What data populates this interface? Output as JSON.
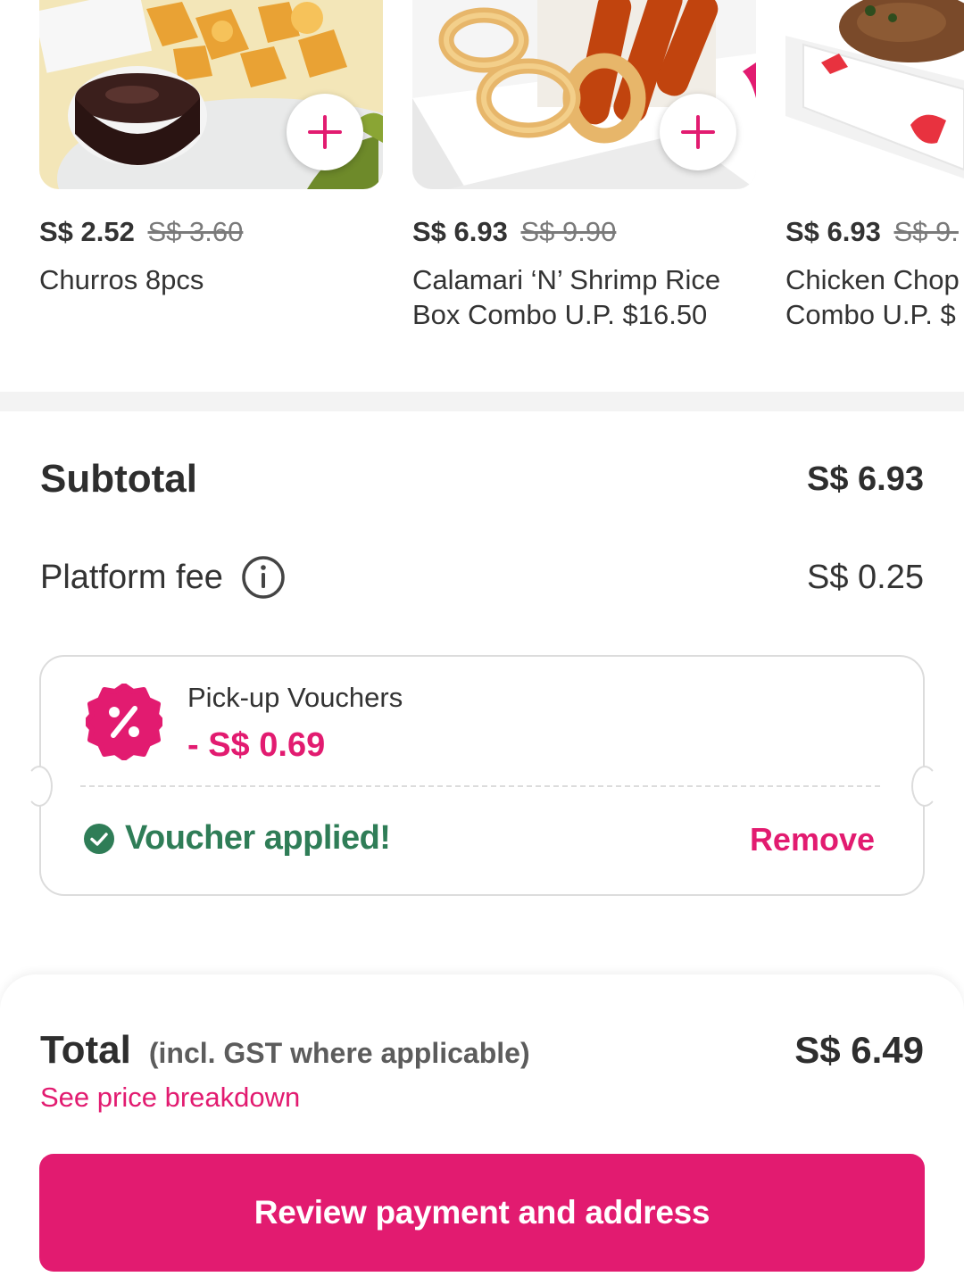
{
  "products": [
    {
      "name": "Churros 8pcs",
      "price": "S$ 2.52",
      "old_price": "S$ 3.60",
      "image_icon": "churros-image"
    },
    {
      "name": "Calamari ‘N’ Shrimp Rice\nBox Combo U.P. $16.50",
      "price": "S$ 6.93",
      "old_price": "S$ 9.90",
      "image_icon": "calamari-shrimp-image"
    },
    {
      "name": "Chicken Chop\nCombo U.P. $",
      "price": "S$ 6.93",
      "old_price": "S$ 9.",
      "image_icon": "chicken-chop-image"
    }
  ],
  "summary": {
    "subtotal_label": "Subtotal",
    "subtotal_value": "S$ 6.93",
    "platform_fee_label": "Platform fee",
    "platform_fee_value": "S$ 0.25"
  },
  "voucher": {
    "title": "Pick-up Vouchers",
    "amount": "- S$ 0.69",
    "status": "Voucher applied!",
    "remove_label": "Remove"
  },
  "footer": {
    "total_label": "Total",
    "total_note": "(incl. GST where applicable)",
    "total_value": "S$ 6.49",
    "breakdown_link": "See price breakdown",
    "cta_label": "Review payment and address"
  },
  "colors": {
    "brand": "#e21b70",
    "success": "#2f7d57",
    "text": "#333333",
    "muted": "#7a7a7a"
  }
}
